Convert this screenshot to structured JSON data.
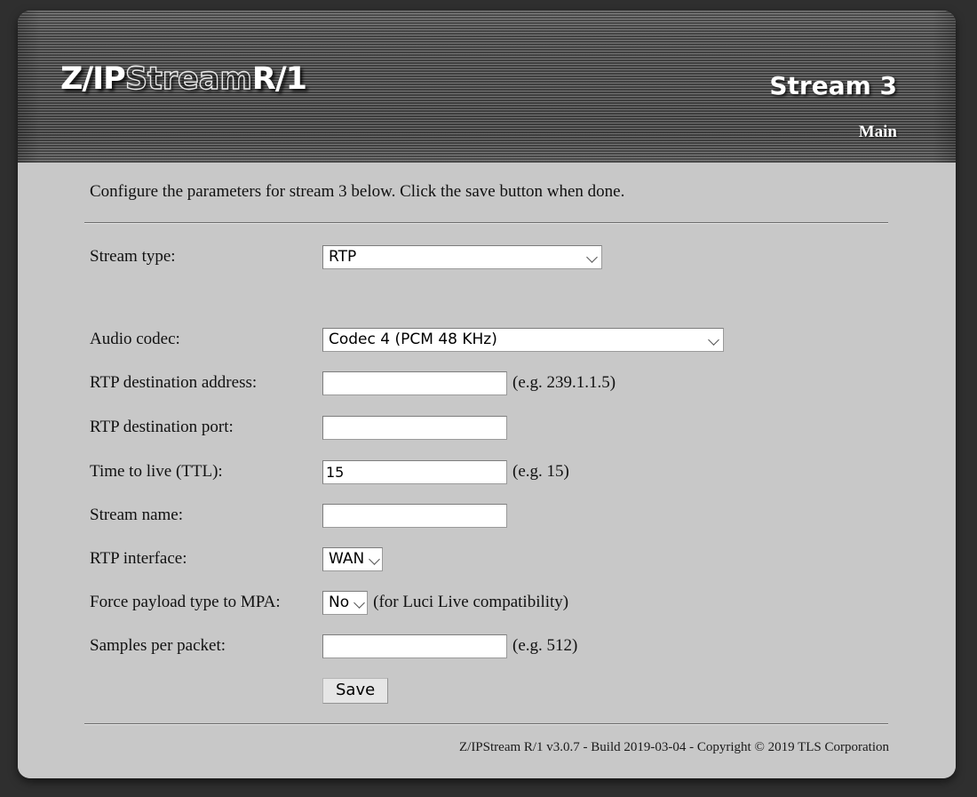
{
  "header": {
    "logo": {
      "part1": "Z/IP",
      "part2": "Stream",
      "part3": "R/1"
    },
    "stream_title": "Stream 3",
    "nav_main": "Main"
  },
  "content": {
    "intro": "Configure the parameters for stream 3 below. Click the save button when done.",
    "fields": {
      "stream_type": {
        "label": "Stream type:",
        "value": "RTP"
      },
      "audio_codec": {
        "label": "Audio codec:",
        "value": "Codec 4 (PCM 48 KHz)"
      },
      "rtp_destination_address": {
        "label": "RTP destination address:",
        "value": "",
        "hint": "(e.g. 239.1.1.5)"
      },
      "rtp_destination_port": {
        "label": "RTP destination port:",
        "value": ""
      },
      "time_to_live": {
        "label": "Time to live (TTL):",
        "value": "15",
        "hint": "(e.g. 15)"
      },
      "stream_name": {
        "label": "Stream name:",
        "value": ""
      },
      "rtp_interface": {
        "label": "RTP interface:",
        "value": "WAN"
      },
      "force_payload_mpa": {
        "label": "Force payload type to MPA:",
        "value": "No",
        "hint": "(for Luci Live compatibility)"
      },
      "samples_per_packet": {
        "label": "Samples per packet:",
        "value": "",
        "hint": "(e.g. 512)"
      }
    },
    "save_label": "Save"
  },
  "footer": {
    "text": "Z/IPStream R/1 v3.0.7 - Build 2019-03-04 - Copyright © 2019 TLS Corporation"
  },
  "colors": {
    "page_background": "#c8c8c8",
    "desktop_background": "#2f2f2f",
    "header_background": "#5a5a5a",
    "text": "#111111",
    "field_background": "#ffffff"
  }
}
